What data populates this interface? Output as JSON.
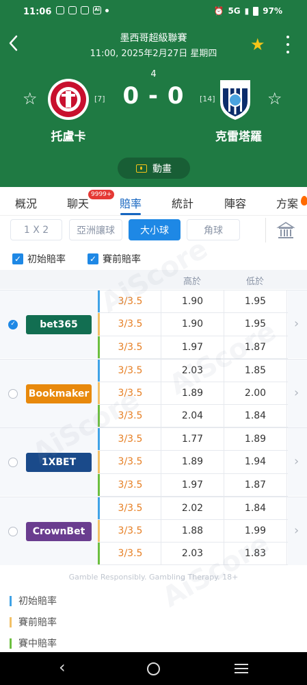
{
  "status_bar": {
    "time": "11:06",
    "network": "5G",
    "battery": "97%"
  },
  "header": {
    "league": "墨西哥超級聯賽",
    "datetime": "11:00, 2025年2月27日 星期四",
    "round": "4",
    "home": {
      "name": "托盧卡",
      "rank": "[7]"
    },
    "away": {
      "name": "克雷塔羅",
      "rank": "[14]"
    },
    "score": "0 - 0",
    "animation_label": "動畫",
    "colors": {
      "header_bg": "#1f7a43",
      "star": "#f5c518"
    }
  },
  "tabs": [
    {
      "label": "概況"
    },
    {
      "label": "聊天",
      "badge": "9999+"
    },
    {
      "label": "賠率",
      "active": true
    },
    {
      "label": "統計"
    },
    {
      "label": "陣容"
    },
    {
      "label": "方案"
    }
  ],
  "market_tabs": [
    {
      "label": "1 X 2"
    },
    {
      "label": "亞洲讓球"
    },
    {
      "label": "大小球",
      "active": true
    },
    {
      "label": "角球"
    }
  ],
  "filters": {
    "initial": "初始賠率",
    "pre_match": "賽前賠率"
  },
  "table": {
    "header_high": "高於",
    "header_low": "低於",
    "bookmakers": [
      {
        "name": "bet365",
        "logo_text": "bet365",
        "selected": true,
        "color": "#126e51",
        "rows": [
          [
            "3/3.5",
            "1.90",
            "1.95"
          ],
          [
            "3/3.5",
            "1.90",
            "1.95"
          ],
          [
            "3/3.5",
            "1.97",
            "1.87"
          ]
        ]
      },
      {
        "name": "Bookmaker",
        "logo_text": "Bookmaker",
        "selected": false,
        "color": "#e8890c",
        "rows": [
          [
            "3/3.5",
            "2.03",
            "1.85"
          ],
          [
            "3/3.5",
            "1.89",
            "2.00"
          ],
          [
            "3/3.5",
            "2.04",
            "1.84"
          ]
        ]
      },
      {
        "name": "1XBET",
        "logo_text": "1XBET",
        "selected": false,
        "color": "#1a4a8a",
        "rows": [
          [
            "3/3.5",
            "1.77",
            "1.89"
          ],
          [
            "3/3.5",
            "1.89",
            "1.94"
          ],
          [
            "3/3.5",
            "1.97",
            "1.87"
          ]
        ]
      },
      {
        "name": "CrownBet",
        "logo_text": "CrownBet",
        "selected": false,
        "color": "#6a3d8f",
        "rows": [
          [
            "3/3.5",
            "2.02",
            "1.84"
          ],
          [
            "3/3.5",
            "1.88",
            "1.99"
          ],
          [
            "3/3.5",
            "2.03",
            "1.83"
          ]
        ]
      }
    ]
  },
  "disclaimer": "Gamble Responsibly. Gambling Therapy. 18+",
  "legend": [
    {
      "label": "初始賠率",
      "color": "#3fa2e6"
    },
    {
      "label": "賽前賠率",
      "color": "#f2c066"
    },
    {
      "label": "賽中賠率",
      "color": "#6cbf3f"
    }
  ],
  "watermark": "AiScore"
}
